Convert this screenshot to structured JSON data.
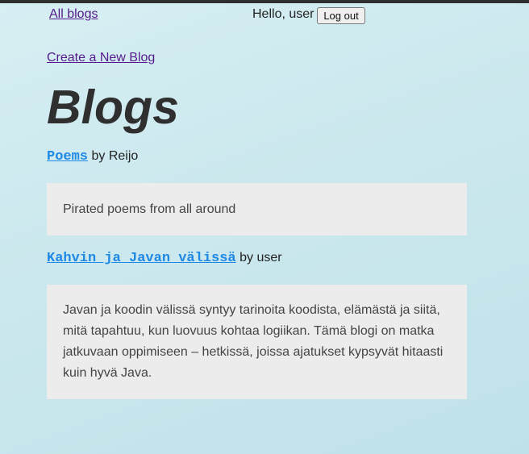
{
  "nav": {
    "home_link": "All blogs",
    "greeting": "Hello, user",
    "logout_label": "Log out"
  },
  "main": {
    "create_link": "Create a New Blog",
    "title": "Blogs",
    "blogs": [
      {
        "title": "Poems",
        "byline": "by Reijo",
        "description": "Pirated poems from all around"
      },
      {
        "title": "Kahvin ja Javan välissä",
        "byline": "by user",
        "description": "Javan ja koodin välissä syntyy tarinoita koodista, elämästä ja siitä, mitä tapahtuu, kun luovuus kohtaa logiikan. Tämä blogi on matka jatkuvaan oppimiseen – hetkissä, joissa ajatukset kypsyvät hitaasti kuin hyvä Java."
      }
    ]
  }
}
